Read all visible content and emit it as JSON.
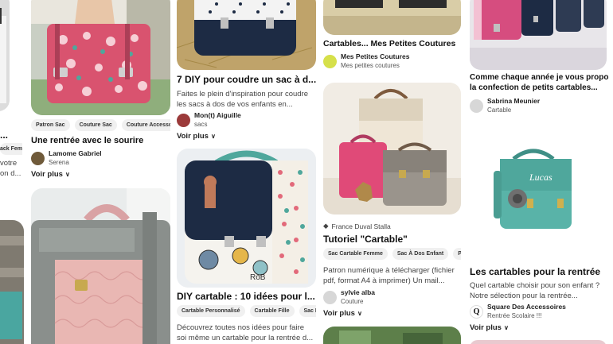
{
  "col0": {
    "title_partial": "...",
    "tag_partial": "ack Fem",
    "desc_partial_1": "votre",
    "desc_partial_2": "on d..."
  },
  "pin1": {
    "tags": [
      "Patron Sac",
      "Couture Sac",
      "Couture Accessoire"
    ],
    "title": "Une rentrée avec le sourire",
    "creator_name": "Lamome Gabriel",
    "creator_sub": "Serena",
    "see_more": "Voir plus"
  },
  "pin2": {
    "title": "7 DIY pour coudre un sac à d...",
    "desc_line1": "Faites le plein d'inspiration pour coudre",
    "desc_line2": "les sacs à dos de vos enfants en...",
    "creator_name": "Mon(t) Aiguille",
    "creator_sub": "sacs",
    "see_more": "Voir plus"
  },
  "pin3": {
    "title": "DIY cartable : 10 idées pour l...",
    "tags": [
      "Cartable Personnalisé",
      "Cartable Fille",
      "Sac Fe"
    ],
    "desc_line1": "Découvrez toutes nos idées pour faire",
    "desc_line2": "soi même un cartable pour la rentrée d..."
  },
  "pin4": {
    "title": "Cartables... Mes Petites Coutures",
    "creator_name": "Mes Petites Coutures",
    "creator_sub": "Mes petites coutures"
  },
  "pin5": {
    "source": "France Duval Stalla",
    "title": "Tutoriel \"Cartable\"",
    "tags": [
      "Sac Cartable Femme",
      "Sac À Dos Enfant",
      "Peti"
    ],
    "desc_line1": "Patron numérique à télécharger (fichier",
    "desc_line2": "pdf, format A4 à imprimer) Un mail...",
    "creator_name": "sylvie alba",
    "creator_sub": "Couture",
    "see_more": "Voir plus"
  },
  "pin6": {
    "title_line1": "Comme chaque année je vous propose",
    "title_line2": "la confection de petits cartables...",
    "creator_name": "Sabrina Meunier",
    "creator_sub": "Cartable"
  },
  "pin7": {
    "bag_text": "Lucas",
    "title": "Les cartables pour la rentrée",
    "desc_line1": "Quel cartable choisir pour son enfant ?",
    "desc_line2": "Notre sélection pour la rentrée...",
    "creator_name": "Square Des Accessoires",
    "creator_sub": "Rentrée Scolaire !!!",
    "see_more": "Voir plus"
  },
  "colors": {
    "accent_pink": "#d9536f",
    "teal": "#4fa79c",
    "navy": "#1d2b44",
    "gray_bag": "#8a8f8c"
  }
}
